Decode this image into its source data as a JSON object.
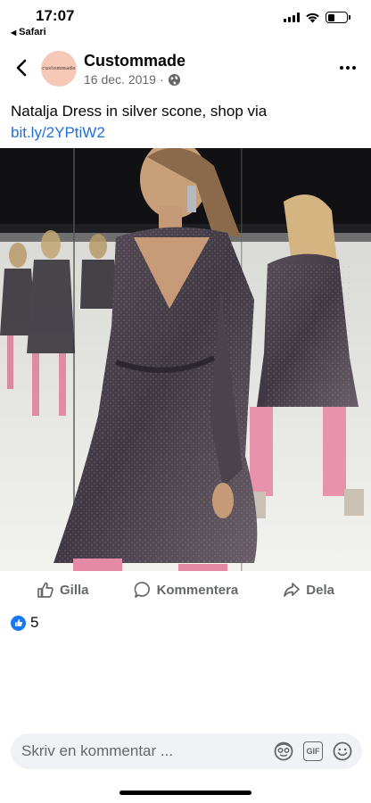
{
  "status_bar": {
    "time": "17:07",
    "back_app": "Safari"
  },
  "post": {
    "page_name": "Custommade",
    "avatar_text": "custommade",
    "date": "16 dec. 2019",
    "separator": "·",
    "privacy_icon": "globe-icon",
    "text_prefix": "Natalja Dress in silver scone, shop via ",
    "link_text": "bit.ly/2YPtiW2",
    "image_alt": "Model wearing a dark glitter wrap dress with pink tights in a mirrored room"
  },
  "actions": {
    "like_label": "Gilla",
    "comment_label": "Kommentera",
    "share_label": "Dela"
  },
  "reactions": {
    "count": "5",
    "icon": "like-reaction-icon"
  },
  "comment_bar": {
    "placeholder": "Skriv en kommentar ...",
    "icons": [
      "avatar-sticker-icon",
      "gif-icon",
      "emoji-icon"
    ],
    "gif_text": "GIF"
  },
  "colors": {
    "link": "#216fdb",
    "like_blue": "#1877f2",
    "secondary_text": "#65676b",
    "comment_bg": "#f0f2f5"
  }
}
